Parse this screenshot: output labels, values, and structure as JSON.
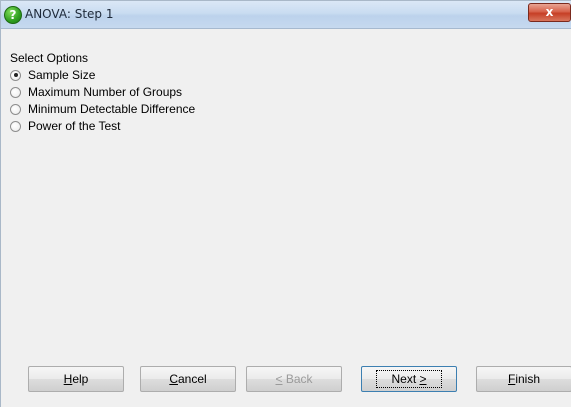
{
  "window": {
    "title": "ANOVA: Step 1",
    "title_icon": "help-question-icon",
    "close_glyph": "x"
  },
  "options": {
    "group_label": "Select Options",
    "items": [
      {
        "label": "Sample Size",
        "checked": true
      },
      {
        "label": "Maximum Number of Groups",
        "checked": false
      },
      {
        "label": "Minimum Detectable Difference",
        "checked": false
      },
      {
        "label": "Power of the Test",
        "checked": false
      }
    ]
  },
  "buttons": {
    "help": {
      "mnemonic": "H",
      "rest": "elp"
    },
    "cancel": {
      "mnemonic": "C",
      "rest": "ancel"
    },
    "back": {
      "mnemonic": "<",
      "rest": " Back",
      "disabled": true
    },
    "next": {
      "prefix": "Next ",
      "mnemonic": ">",
      "default": true
    },
    "finish": {
      "mnemonic": "F",
      "rest": "inish"
    }
  }
}
